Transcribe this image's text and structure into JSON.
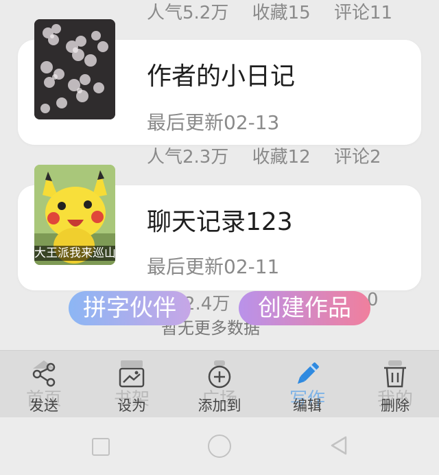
{
  "items": [
    {
      "title": "",
      "updated": "",
      "stats": [
        "人气5.2万",
        "收藏15",
        "评论11"
      ]
    },
    {
      "title": "作者的小日记",
      "updated": "最后更新02-13",
      "stats": [
        "人气2.3万",
        "收藏12",
        "评论2"
      ]
    },
    {
      "title": "聊天记录123",
      "updated": "最后更新02-11",
      "stats_partial": [
        "2.4万",
        "0"
      ],
      "thumb_caption": "大王派我来巡山"
    }
  ],
  "buttons": {
    "partner": "拼字伙伴",
    "create": "创建作品"
  },
  "load_more": "暂无更多数据",
  "tabs": [
    {
      "ghost": "首页",
      "label": "发送",
      "icon": "share-icon"
    },
    {
      "ghost": "书架",
      "label": "设为",
      "icon": "image-frame-icon"
    },
    {
      "ghost": "广场",
      "label": "添加到",
      "icon": "add-circle-icon"
    },
    {
      "ghost": "写作",
      "label": "编辑",
      "icon": "pen-icon",
      "active": true
    },
    {
      "ghost": "我的",
      "label": "删除",
      "icon": "trash-icon"
    }
  ],
  "colors": {
    "active": "#2f8ae0",
    "partner_gradient": [
      "#8cb6f4",
      "#c6a6e6"
    ],
    "create_gradient": [
      "#b992ea",
      "#f07f9d"
    ]
  }
}
